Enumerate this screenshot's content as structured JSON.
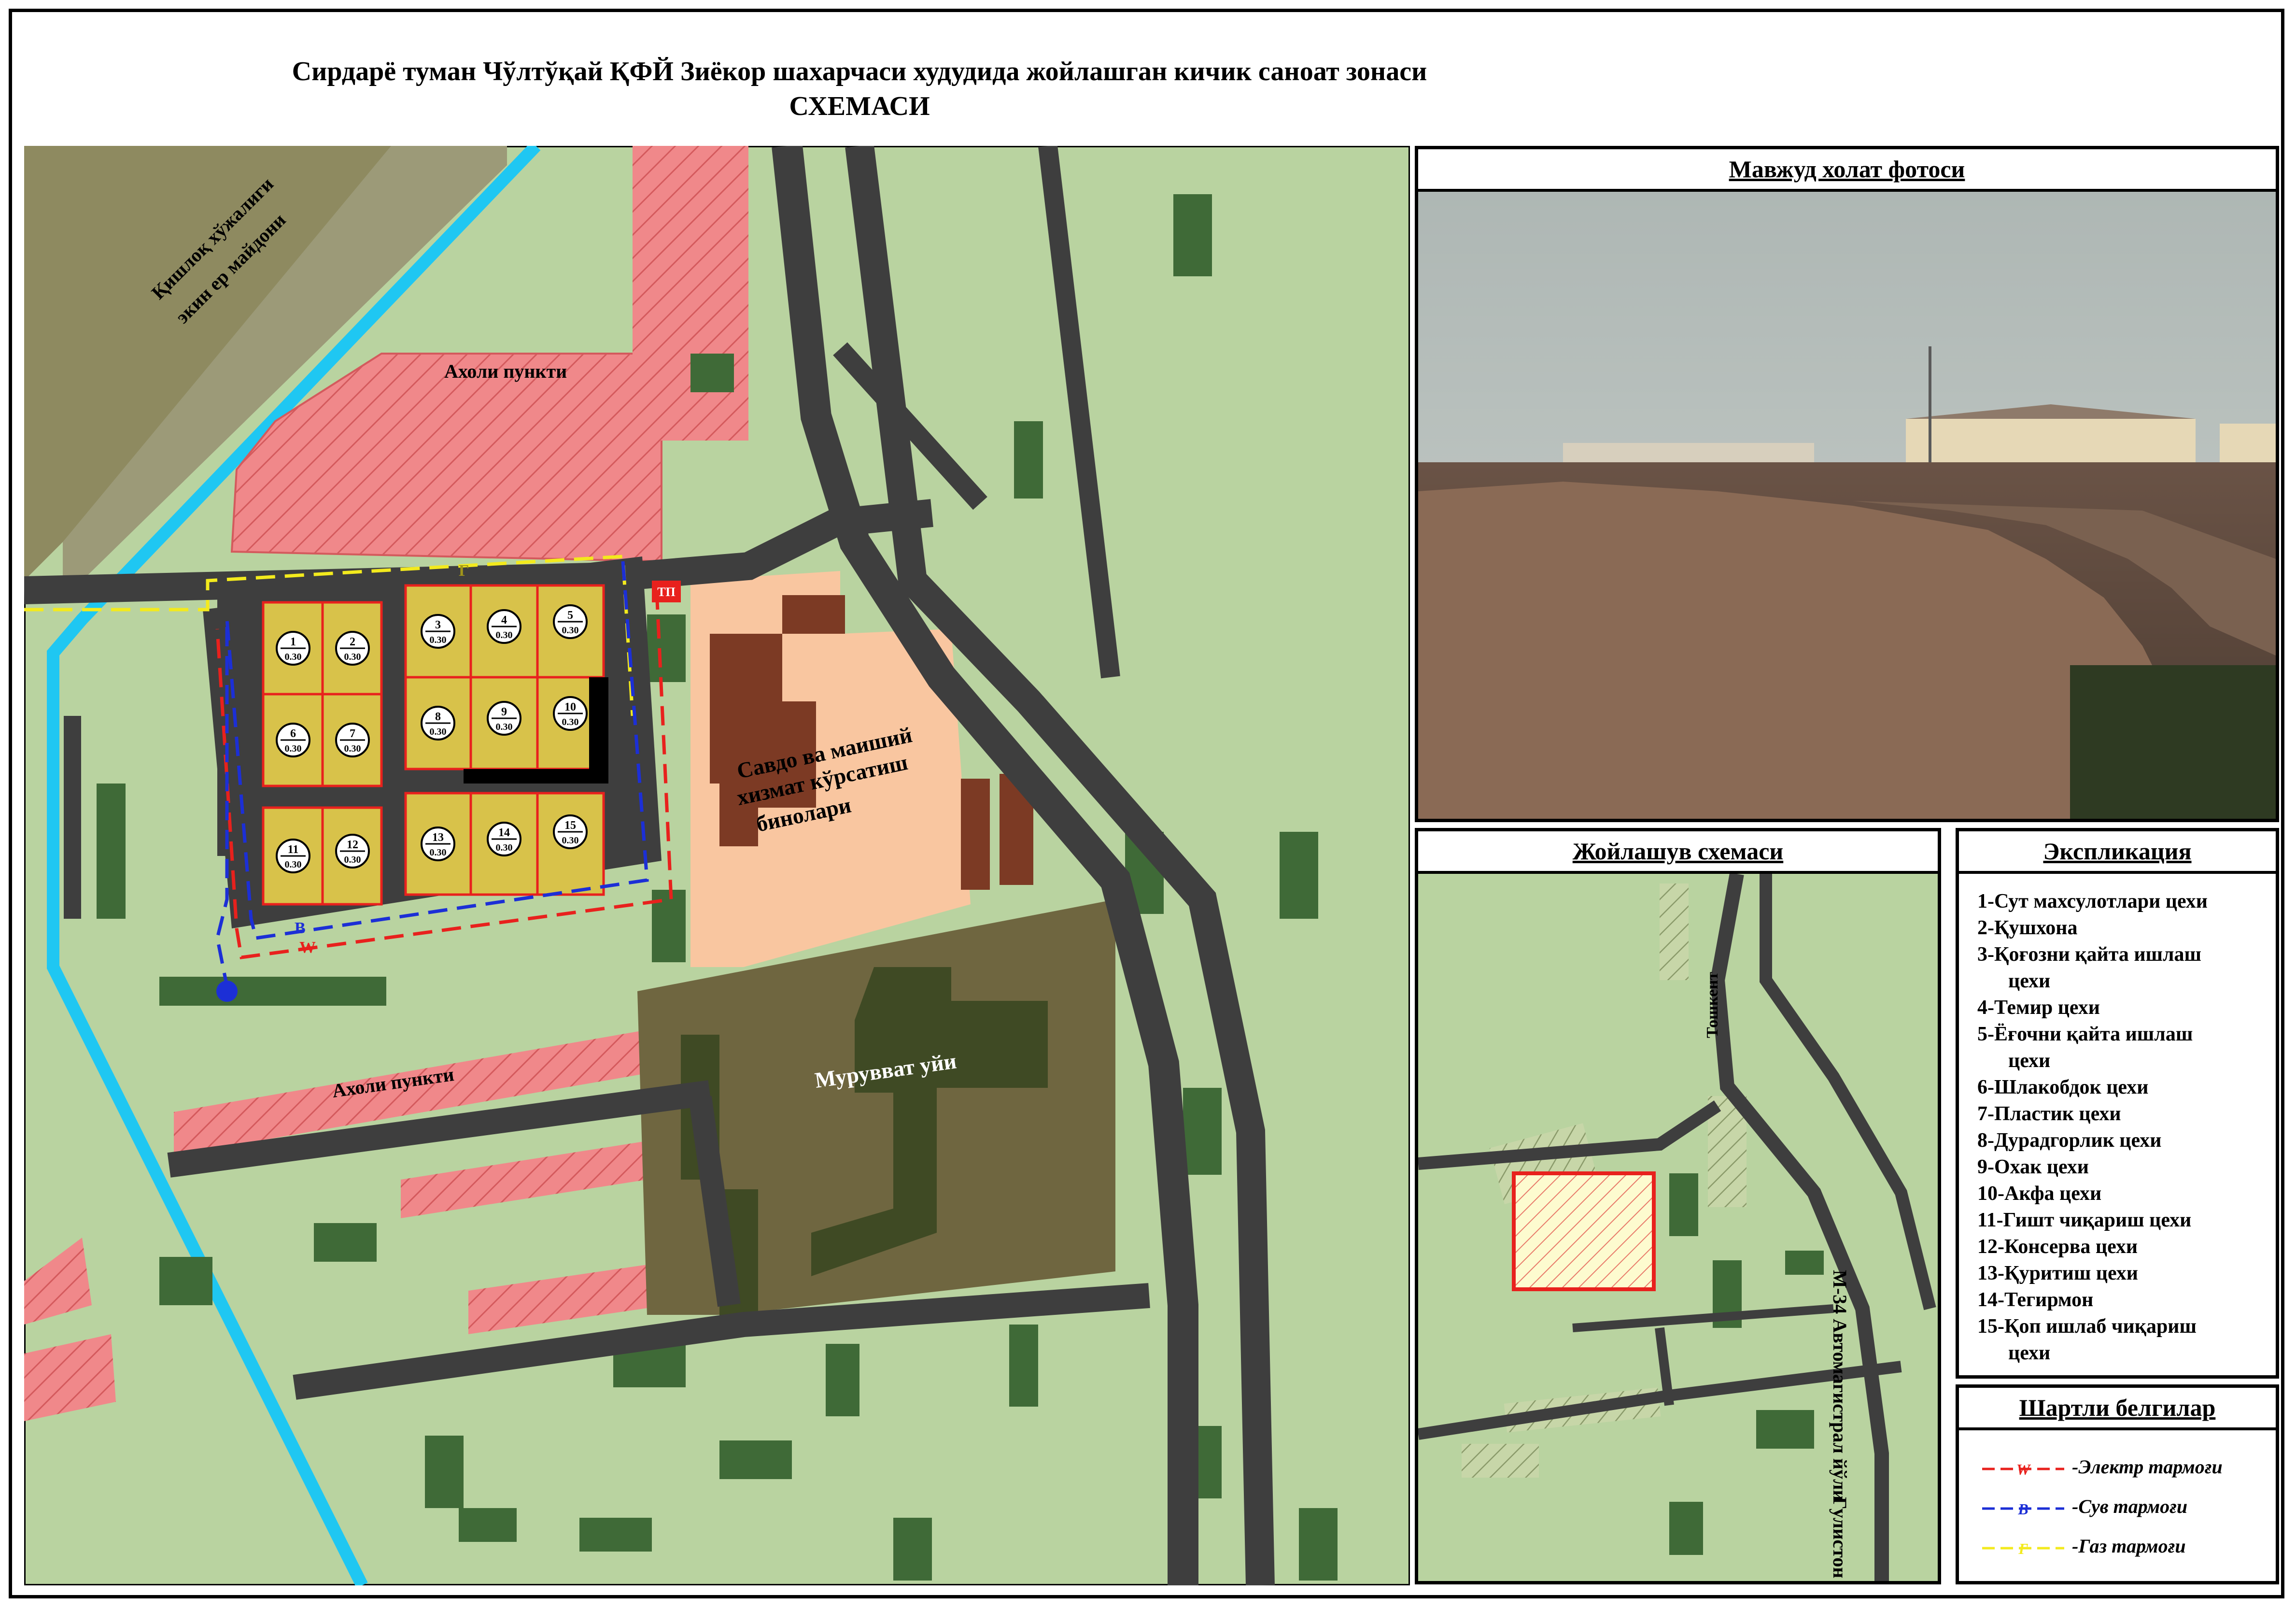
{
  "title": {
    "line1": "Сирдарё туман Чўлтўқай ҚФЙ Зиёкор шахарчаси худудида жойлашган кичик саноат зонаси",
    "line2": "СХЕМАСИ"
  },
  "main_map": {
    "labels": {
      "farm_land_1": "Қишлоқ хўжалиги",
      "farm_land_2": "экин ер майдони",
      "settlement_top": "Ахоли пункти",
      "settlement_bottom": "Ахоли пункти",
      "trade_1": "Савдо ва маиший",
      "trade_2": "хизмат кўрсатиш",
      "trade_3": "бинолари",
      "charity_house": "Мурувват уйи",
      "transformer": "ТП"
    },
    "plots": [
      {
        "number": "1",
        "area": "0.30"
      },
      {
        "number": "2",
        "area": "0.30"
      },
      {
        "number": "3",
        "area": "0.30"
      },
      {
        "number": "4",
        "area": "0.30"
      },
      {
        "number": "5",
        "area": "0.30"
      },
      {
        "number": "6",
        "area": "0.30"
      },
      {
        "number": "7",
        "area": "0.30"
      },
      {
        "number": "8",
        "area": "0.30"
      },
      {
        "number": "9",
        "area": "0.30"
      },
      {
        "number": "10",
        "area": "0.30"
      },
      {
        "number": "11",
        "area": "0.30"
      },
      {
        "number": "12",
        "area": "0.30"
      },
      {
        "number": "13",
        "area": "0.30"
      },
      {
        "number": "14",
        "area": "0.30"
      },
      {
        "number": "15",
        "area": "0.30"
      }
    ],
    "line_markers": {
      "electric": "W",
      "water": "В",
      "gas": "Г"
    }
  },
  "photo_panel": {
    "title": "Мавжуд холат фотоси"
  },
  "location_panel": {
    "title": "Жойлашув схемаси",
    "road_tashkent": "Тошкент",
    "road_highway": "М-34 Автомагистрал йўли",
    "road_gulistan": "Гулистон"
  },
  "explication": {
    "title": "Экспликация",
    "items": [
      {
        "text": "1-Сут махсулотлари цехи"
      },
      {
        "text": "2-Қушхона"
      },
      {
        "text": "3-Қоғозни қайта ишлаш",
        "cont": "цехи"
      },
      {
        "text": "4-Темир цехи"
      },
      {
        "text": "5-Ёғочни қайта ишлаш",
        "cont": "цехи"
      },
      {
        "text": "6-Шлакобдок цехи"
      },
      {
        "text": "7-Пластик цехи"
      },
      {
        "text": "8-Дурадгорлик цехи"
      },
      {
        "text": "9-Охак цехи"
      },
      {
        "text": "10-Акфа цехи"
      },
      {
        "text": "11-Гишт чиқариш цехи"
      },
      {
        "text": "12-Консерва цехи"
      },
      {
        "text": "13-Қуритиш цехи"
      },
      {
        "text": "14-Тегирмон"
      },
      {
        "text": "15-Қоп ишлаб чиқариш",
        "cont": "цехи"
      }
    ]
  },
  "legend": {
    "title": "Шартли белгилар",
    "items": [
      {
        "symbol": "W",
        "label": "-Электр тармоғи",
        "color": "#e8211d"
      },
      {
        "symbol": "В",
        "label": "-Сув тармоғи",
        "color": "#1c2fd6"
      },
      {
        "symbol": "Г",
        "label": "-Газ тармоғи",
        "color": "#f3ea1d"
      }
    ]
  },
  "colors": {
    "land": "#b9d3a0",
    "road": "#3e3e3e",
    "residential": "#f0888a",
    "building": "#3f6a37",
    "plot": "#d8c24a",
    "trade": "#f9c6a0",
    "trade_building": "#7c3a24",
    "charity_area": "#6f6640",
    "water": "#1fc7f2",
    "electric": "#e8211d",
    "pipe": "#1c2fd6",
    "gas": "#f3ea1d"
  }
}
